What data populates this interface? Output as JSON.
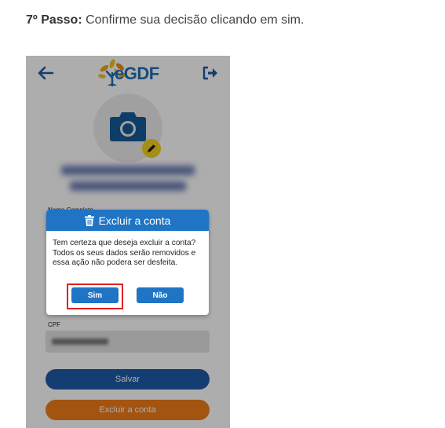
{
  "instruction": {
    "step": "7º Passo:",
    "text": " Confirme sua decisão clicando em sim."
  },
  "app": {
    "logo_text": "eGDF",
    "fields": {
      "name_label": "Nome Completo",
      "cpf_label": "CPF"
    },
    "buttons": {
      "save": "Salvar",
      "delete_account": "Excluir a conta"
    }
  },
  "dialog": {
    "title": "Excluir a conta",
    "message": "Tem certeza que deseja excluir a conta? Todos os seus dados serão removidos e essa ação não podera ser desfeita.",
    "yes": "Sim",
    "no": "Não"
  },
  "colors": {
    "primary": "#1f74c4",
    "dark_blue": "#1e5aa8",
    "orange": "#f07d1a",
    "yellow": "#f5d220",
    "highlight": "#e02020"
  }
}
